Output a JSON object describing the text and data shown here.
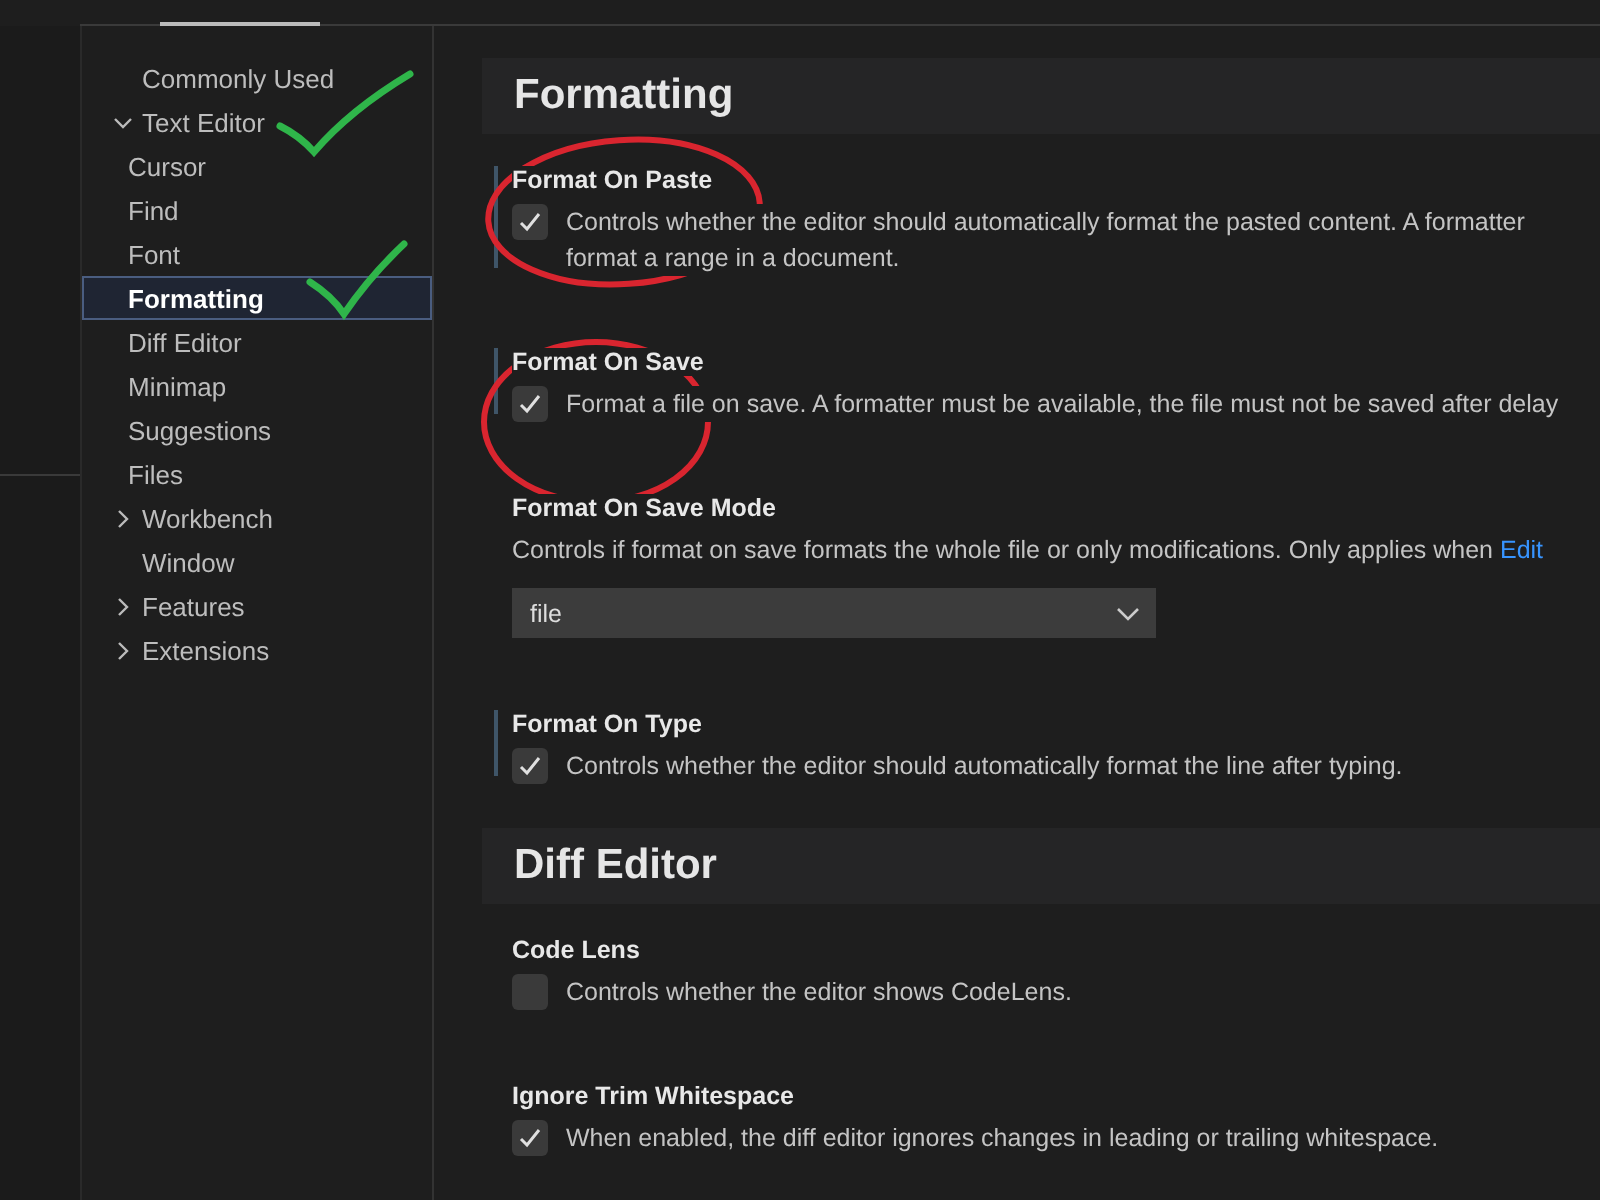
{
  "sidebar": {
    "items": [
      {
        "label": "Commonly Used",
        "kind": "leaf",
        "selected": false
      },
      {
        "label": "Text Editor",
        "kind": "group",
        "expanded": true,
        "selected": false,
        "children": [
          {
            "label": "Cursor",
            "kind": "leaf",
            "selected": false
          },
          {
            "label": "Find",
            "kind": "leaf",
            "selected": false
          },
          {
            "label": "Font",
            "kind": "leaf",
            "selected": false
          },
          {
            "label": "Formatting",
            "kind": "leaf",
            "selected": true
          },
          {
            "label": "Diff Editor",
            "kind": "leaf",
            "selected": false
          },
          {
            "label": "Minimap",
            "kind": "leaf",
            "selected": false
          },
          {
            "label": "Suggestions",
            "kind": "leaf",
            "selected": false
          },
          {
            "label": "Files",
            "kind": "leaf",
            "selected": false
          }
        ]
      },
      {
        "label": "Workbench",
        "kind": "group",
        "expanded": false,
        "selected": false
      },
      {
        "label": "Window",
        "kind": "leaf",
        "selected": false
      },
      {
        "label": "Features",
        "kind": "group",
        "expanded": false,
        "selected": false
      },
      {
        "label": "Extensions",
        "kind": "group",
        "expanded": false,
        "selected": false
      }
    ]
  },
  "sections": [
    {
      "title": "Formatting",
      "settings": [
        {
          "kind": "checkbox",
          "title": "Format On Paste",
          "modified": true,
          "checked": true,
          "description": "Controls whether the editor should automatically format the pasted content. A formatter",
          "description_2": "format a range in a document."
        },
        {
          "kind": "checkbox",
          "title": "Format On Save",
          "modified": true,
          "checked": true,
          "description": "Format a file on save. A formatter must be available, the file must not be saved after delay"
        },
        {
          "kind": "dropdown",
          "title": "Format On Save Mode",
          "modified": false,
          "description": "Controls if format on save formats the whole file or only modifications. Only applies when",
          "link": "Edit",
          "value": "file"
        },
        {
          "kind": "checkbox",
          "title": "Format On Type",
          "modified": true,
          "checked": true,
          "description": "Controls whether the editor should automatically format the line after typing."
        }
      ]
    },
    {
      "title": "Diff Editor",
      "settings": [
        {
          "kind": "checkbox",
          "title": "Code Lens",
          "modified": false,
          "checked": false,
          "description": "Controls whether the editor shows CodeLens."
        },
        {
          "kind": "checkbox",
          "title": "Ignore Trim Whitespace",
          "modified": false,
          "checked": true,
          "description": "When enabled, the diff editor ignores changes in leading or trailing whitespace."
        }
      ]
    }
  ]
}
